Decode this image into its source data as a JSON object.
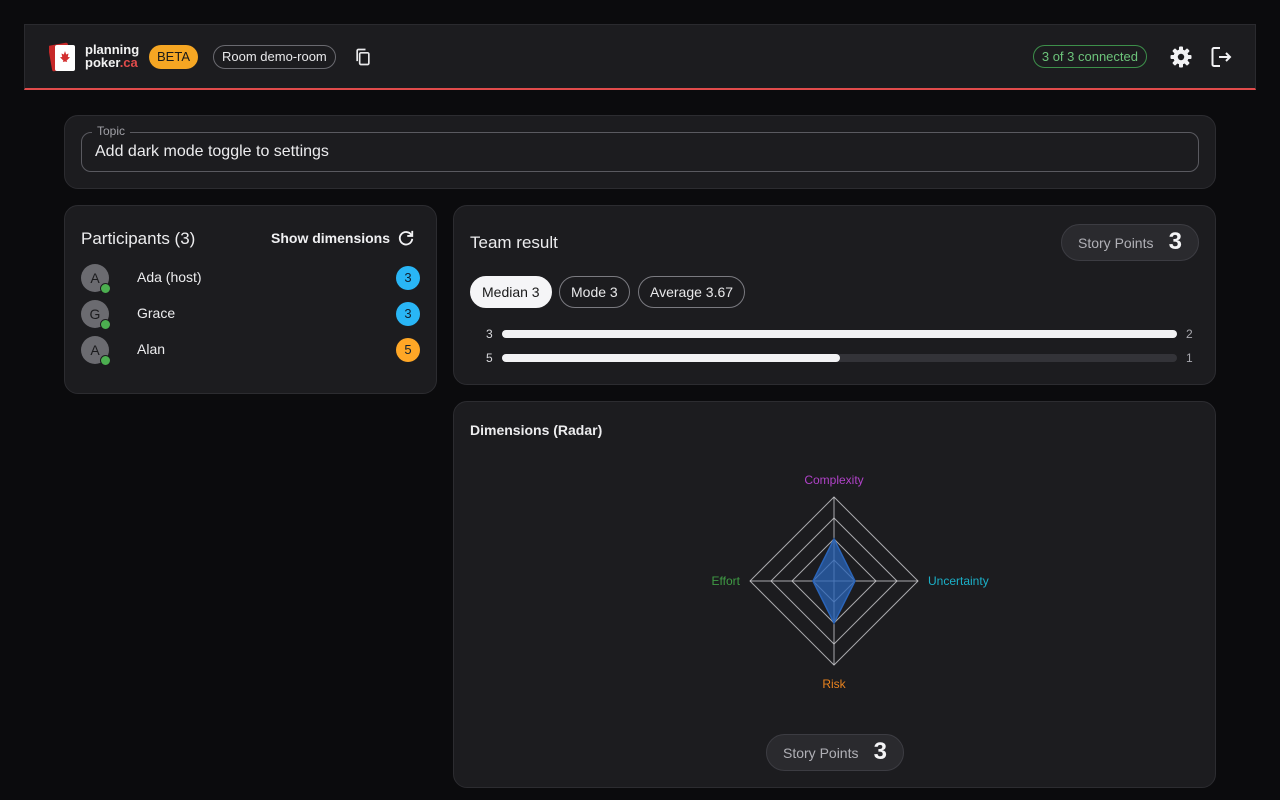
{
  "header": {
    "brand_line1": "planning",
    "brand_line2": "poker",
    "brand_suffix": ".ca",
    "beta": "BETA",
    "room": "Room demo-room",
    "connected": "3 of 3 connected",
    "icons": [
      "card-logo-icon",
      "copy-icon",
      "gear-icon",
      "logout-icon"
    ],
    "accent_color": "#e04b4b"
  },
  "topic": {
    "label": "Topic",
    "value": "Add dark mode toggle to settings"
  },
  "participants": {
    "title": "Participants (3)",
    "show_dimensions": "Show dimensions",
    "list": [
      {
        "initial": "A",
        "name": "Ada (host)",
        "vote": "3",
        "vote_color": "#29b6f6",
        "online": true
      },
      {
        "initial": "G",
        "name": "Grace",
        "vote": "3",
        "vote_color": "#29b6f6",
        "online": true
      },
      {
        "initial": "A",
        "name": "Alan",
        "vote": "5",
        "vote_color": "#ffa726",
        "online": true
      }
    ]
  },
  "result": {
    "title": "Team result",
    "sp_label": "Story Points",
    "sp_value": "3",
    "stats": [
      {
        "label": "Median 3",
        "active": true
      },
      {
        "label": "Mode 3",
        "active": false
      },
      {
        "label": "Average 3.67",
        "active": false
      }
    ],
    "distribution": [
      {
        "value": "3",
        "count": "2",
        "fraction": 1.0
      },
      {
        "value": "5",
        "count": "1",
        "fraction": 0.5
      }
    ]
  },
  "radar": {
    "title": "Dimensions (Radar)",
    "sp_label": "Story Points",
    "sp_value": "3",
    "chart_data": {
      "type": "radar",
      "axes": [
        {
          "label": "Complexity",
          "color": "#b042c8",
          "value": 2
        },
        {
          "label": "Uncertainty",
          "color": "#1bb0c8",
          "value": 1
        },
        {
          "label": "Risk",
          "color": "#e8821e",
          "value": 2
        },
        {
          "label": "Effort",
          "color": "#3f9a44",
          "value": 1
        }
      ],
      "max": 4,
      "rings": 4,
      "fill_color": "#2a64b8"
    }
  }
}
